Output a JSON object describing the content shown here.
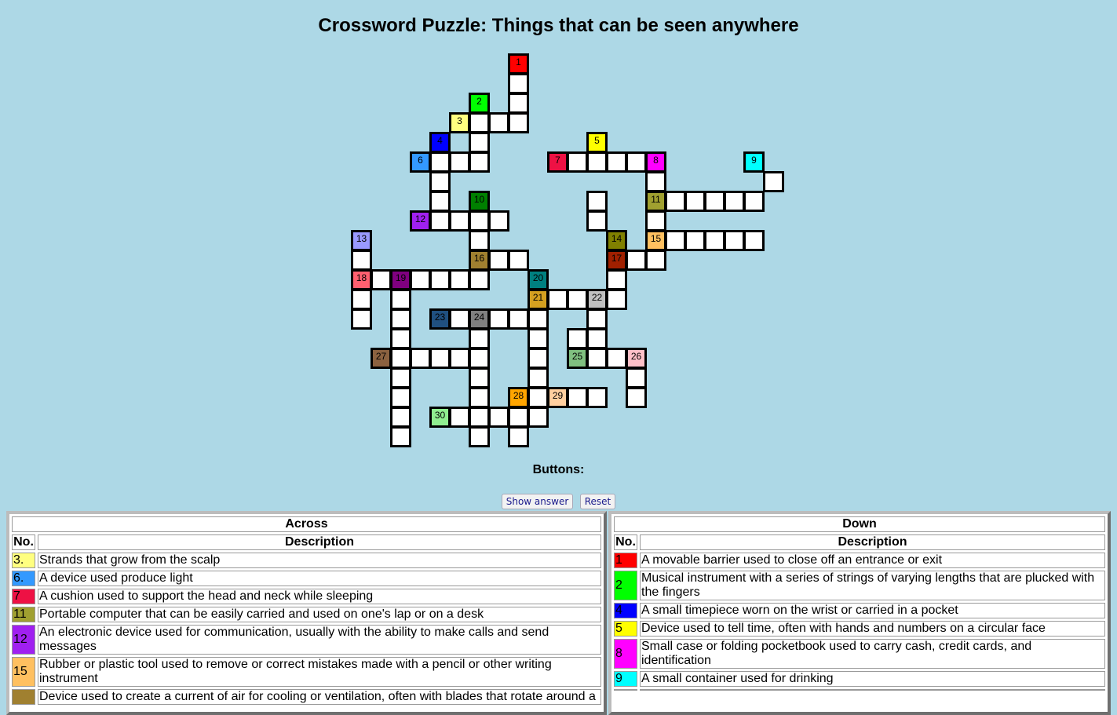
{
  "title": "Crossword Puzzle: Things that can be seen anywhere",
  "buttons_label": "Buttons:",
  "buttons": {
    "show_answer": "Show answer",
    "reset": "Reset"
  },
  "grid_numbers": [
    {
      "n": "1",
      "color": "#ff0000"
    },
    {
      "n": "2",
      "color": "#00ff00"
    },
    {
      "n": "3",
      "color": "#ffff80"
    },
    {
      "n": "4",
      "color": "#0000ff"
    },
    {
      "n": "5",
      "color": "#ffff00"
    },
    {
      "n": "6",
      "color": "#3399ff"
    },
    {
      "n": "7",
      "color": "#ee1144"
    },
    {
      "n": "8",
      "color": "#ff00ff"
    },
    {
      "n": "9",
      "color": "#00ffff"
    },
    {
      "n": "10",
      "color": "#008000"
    },
    {
      "n": "11",
      "color": "#a0a030"
    },
    {
      "n": "12",
      "color": "#a020f0"
    },
    {
      "n": "13",
      "color": "#9999ff"
    },
    {
      "n": "14",
      "color": "#808000"
    },
    {
      "n": "15",
      "color": "#ffc060"
    },
    {
      "n": "16",
      "color": "#a08030"
    },
    {
      "n": "17",
      "color": "#a02000"
    },
    {
      "n": "18",
      "color": "#ff6070"
    },
    {
      "n": "19",
      "color": "#800080"
    },
    {
      "n": "20",
      "color": "#008080"
    },
    {
      "n": "21",
      "color": "#d4a020"
    },
    {
      "n": "22",
      "color": "#c0c0c0"
    },
    {
      "n": "23",
      "color": "#205080"
    },
    {
      "n": "24",
      "color": "#808080"
    },
    {
      "n": "25",
      "color": "#80c080"
    },
    {
      "n": "26",
      "color": "#ffc0c8"
    },
    {
      "n": "27",
      "color": "#8b6240"
    },
    {
      "n": "28",
      "color": "#ffa500"
    },
    {
      "n": "29",
      "color": "#ffd0a0"
    },
    {
      "n": "30",
      "color": "#90ee90"
    }
  ],
  "across": {
    "heading": "Across",
    "col_no": "No.",
    "col_desc": "Description",
    "clues": [
      {
        "no": "3.",
        "desc": "Strands that grow from the scalp",
        "color": "#ffff80"
      },
      {
        "no": "6.",
        "desc": "A device used produce light",
        "color": "#3399ff"
      },
      {
        "no": "7",
        "desc": "A cushion used to support the head and neck while sleeping",
        "color": "#ee1144"
      },
      {
        "no": "11",
        "desc": "Portable computer that can be easily carried and used on one's lap or on a desk",
        "color": "#a0a030"
      },
      {
        "no": "12",
        "desc": "An electronic device used for communication, usually with the ability to make calls and send messages",
        "color": "#a020f0"
      },
      {
        "no": "15",
        "desc": "Rubber or plastic tool used to remove or correct mistakes made with a pencil or other writing instrument",
        "color": "#ffc060"
      },
      {
        "no": "",
        "desc": "Device used to create a current of air for cooling or ventilation, often with blades that rotate around a",
        "color": "#a08030"
      }
    ]
  },
  "down": {
    "heading": "Down",
    "col_no": "No.",
    "col_desc": "Description",
    "clues": [
      {
        "no": "1",
        "desc": "A movable barrier used to close off an entrance or exit",
        "color": "#ff0000"
      },
      {
        "no": "2",
        "desc": "Musical instrument with a series of strings of varying lengths that are plucked with the fingers",
        "color": "#00ff00"
      },
      {
        "no": "4",
        "desc": "A small timepiece worn on the wrist or carried in a pocket",
        "color": "#0000ff"
      },
      {
        "no": "5",
        "desc": "Device used to tell time, often with hands and numbers on a circular face",
        "color": "#ffff00"
      },
      {
        "no": "8",
        "desc": "Small case or folding pocketbook used to carry cash, credit cards, and identification",
        "color": "#ff00ff"
      },
      {
        "no": "9",
        "desc": "A small container used for drinking",
        "color": "#00ffff"
      },
      {
        "no": "",
        "desc": "",
        "color": "#008000"
      }
    ]
  }
}
